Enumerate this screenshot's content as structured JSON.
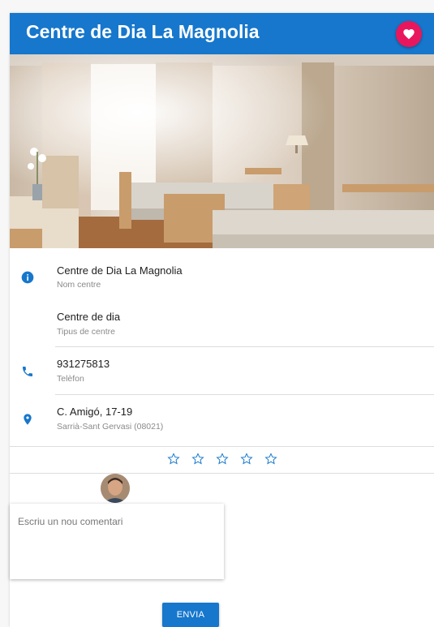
{
  "header": {
    "title": "Centre de Dia La Magnolia",
    "favorite_icon": "heart-icon",
    "color": "#1677cc",
    "favorite_color": "#e8175d"
  },
  "details": {
    "name": {
      "value": "Centre de Dia La Magnolia",
      "label": "Nom centre",
      "icon": "info-icon"
    },
    "type": {
      "value": "Centre de dia",
      "label": "Tipus de centre"
    },
    "phone": {
      "value": "931275813",
      "label": "Telèfon",
      "icon": "phone-icon"
    },
    "address": {
      "value": "C. Amigó, 17-19",
      "label": "Sarrià-Sant Gervasi (08021)",
      "icon": "location-pin-icon"
    }
  },
  "rating": {
    "max": 5,
    "value": 0,
    "icon": "star-outline-icon"
  },
  "comment": {
    "placeholder": "Escriu un nou comentari",
    "value": "",
    "send_label": "ENVIA"
  }
}
